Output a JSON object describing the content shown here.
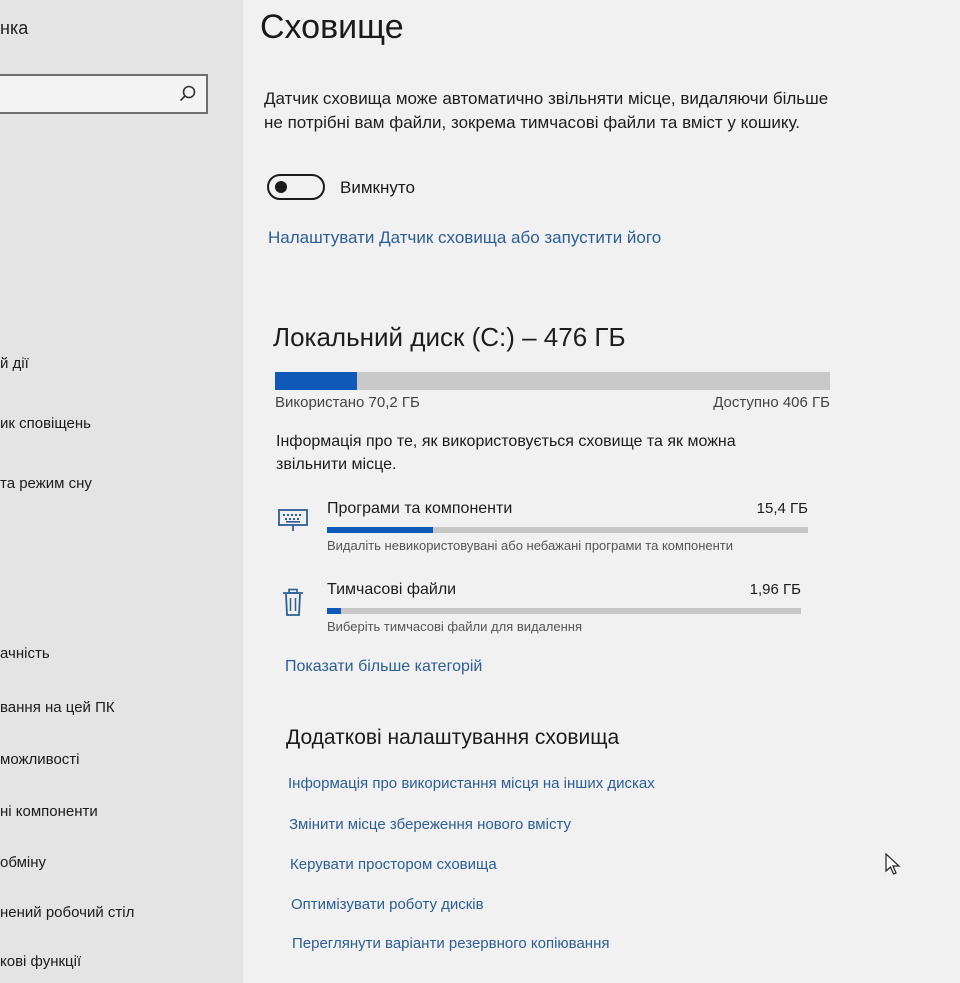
{
  "sidebar": {
    "cut_title": "нка",
    "search": {
      "placeholder": ""
    },
    "items": [
      {
        "label": "й дії"
      },
      {
        "label": "ик сповіщень"
      },
      {
        "label": "та режим сну"
      },
      {
        "label": "ачність"
      },
      {
        "label": "вання на цей ПК"
      },
      {
        "label": "можливості"
      },
      {
        "label": "ні компоненти"
      },
      {
        "label": "обміну"
      },
      {
        "label": "нений робочий стіл"
      },
      {
        "label": "кові функції"
      }
    ]
  },
  "main": {
    "title": "Сховище",
    "storage_sense": {
      "description": "Датчик сховища може автоматично звільняти місце, видаляючи більше не потрібні вам файли, зокрема тимчасові файли та вміст у кошику.",
      "toggle_state": "Вимкнуто",
      "toggle_on": false,
      "configure_link": "Налаштувати Датчик сховища або запустити його"
    },
    "drive": {
      "title": "Локальний диск (C:) – 476 ГБ",
      "used_label": "Використано 70,2 ГБ",
      "free_label": "Доступно 406 ГБ",
      "used_fraction": 0.147,
      "info": "Інформація про те, як використовується сховище та як можна звільнити місце."
    },
    "categories": [
      {
        "name": "Програми та компоненти",
        "size": "15,4 ГБ",
        "description": "Видаліть невикористовувані або небажані програми та компоненти",
        "fill_fraction": 0.22,
        "icon": "keyboard-icon"
      },
      {
        "name": "Тимчасові файли",
        "size": "1,96 ГБ",
        "description": "Виберіть тимчасові файли для видалення",
        "fill_fraction": 0.03,
        "icon": "trash-icon"
      }
    ],
    "more_categories_link": "Показати більше категорій",
    "extra": {
      "title": "Додаткові налаштування сховища",
      "links": [
        "Інформація про використання місця на інших дисках",
        "Змінити місце збереження нового вмісту",
        "Керувати простором сховища",
        "Оптимізувати роботу дисків",
        "Переглянути варіанти резервного копіювання"
      ]
    }
  },
  "colors": {
    "accent": "#0f5ab8",
    "link": "#2c5e95"
  }
}
